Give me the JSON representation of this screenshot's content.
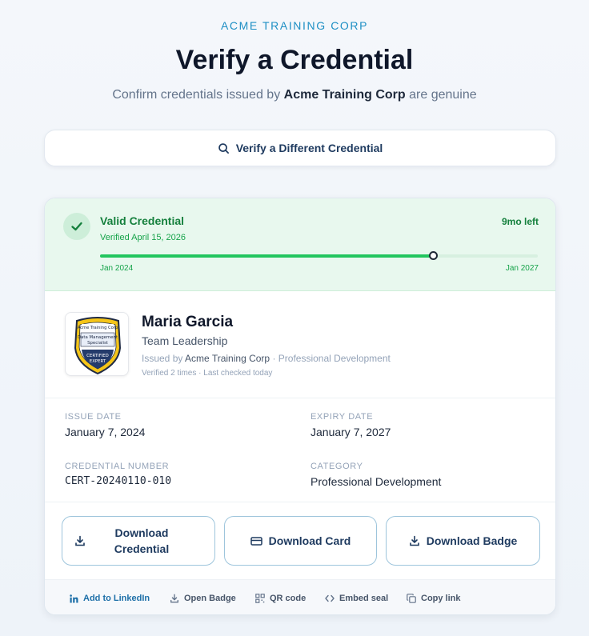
{
  "header": {
    "org_label": "ACME TRAINING CORP",
    "title": "Verify a Credential",
    "subtitle_prefix": "Confirm credentials issued by",
    "subtitle_org": "Acme Training Corp",
    "subtitle_suffix": "are genuine"
  },
  "verify_button": {
    "label": "Verify a Different Credential",
    "icon": "search-icon"
  },
  "status": {
    "title": "Valid Credential",
    "verified_on": "Verified April 15, 2026",
    "time_left": "9mo left",
    "range_start": "Jan 2024",
    "range_end": "Jan 2027",
    "progress": 0.76,
    "colors": {
      "accent": "#22c55e",
      "text": "#15803d",
      "background": "#e8f8ee"
    }
  },
  "holder": {
    "name": "Maria Garcia",
    "course": "Team Leadership",
    "issued_by_prefix": "Issued by",
    "issuer": "Acme Training Corp",
    "category_suffix": "· Professional Development",
    "verification_info": "Verified 2 times · Last checked today",
    "badge": {
      "org": "Acme Training Corp",
      "line1": "Data Management",
      "line2": "Specialist",
      "line3": "CERTIFIED",
      "line4": "EXPERT"
    }
  },
  "details": {
    "issue_date_label": "ISSUE DATE",
    "issue_date": "January 7, 2024",
    "expiry_date_label": "EXPIRY DATE",
    "expiry_date": "January 7, 2027",
    "credential_number_label": "CREDENTIAL NUMBER",
    "credential_number": "CERT-20240110-010",
    "category_label": "CATEGORY",
    "category": "Professional Development"
  },
  "actions": {
    "download_credential_line1": "Download",
    "download_credential_line2": "Credential",
    "download_card": "Download Card",
    "download_badge": "Download Badge"
  },
  "footer": {
    "linkedin": "Add to LinkedIn",
    "open_badge": "Open Badge",
    "qr_code": "QR code",
    "embed_seal": "Embed seal",
    "copy_link": "Copy link"
  }
}
